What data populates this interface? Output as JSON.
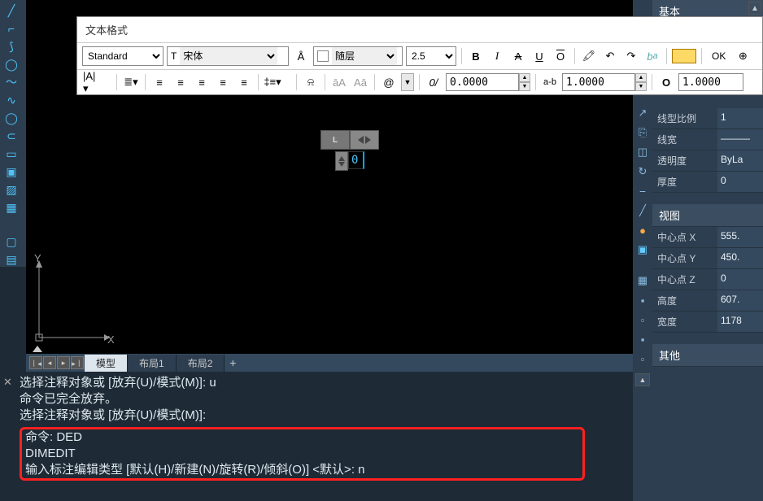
{
  "text_format": {
    "title": "文本格式",
    "style": "Standard",
    "font": "宋体",
    "color": "随层",
    "height": "2.5",
    "bold": "B",
    "italic": "I",
    "strike": "A",
    "underline": "U",
    "overline": "O",
    "ok": "OK",
    "width_factor": "0.0000",
    "tracking": "1.0000",
    "oblique": "1.0000",
    "obl_label": "0/",
    "at_label": "@",
    "ab_label": "a-b",
    "aA": "āA",
    "Aa": "Aā",
    "oval": "O"
  },
  "editor": {
    "text": "0"
  },
  "tabs": {
    "model": "模型",
    "layout1": "布局1",
    "layout2": "布局2"
  },
  "cmd": {
    "l1": "选择注释对象或 [放弃(U)/模式(M)]: u",
    "l2": "命令已完全放弃。",
    "l3": "选择注释对象或 [放弃(U)/模式(M)]:",
    "l4": "命令: DED",
    "l5": "DIMEDIT",
    "l6": "输入标注编辑类型 [默认(H)/新建(N)/旋转(R)/倾斜(O)] <默认>: n"
  },
  "props": {
    "basic_hdr": "基本",
    "ltscale_lbl": "线型比例",
    "ltscale_val": "1",
    "lweight_lbl": "线宽",
    "lweight_val": "———",
    "trans_lbl": "透明度",
    "trans_val": "ByLa",
    "thick_lbl": "厚度",
    "thick_val": "0",
    "view_hdr": "视图",
    "cx_lbl": "中心点 X",
    "cx_val": "555.",
    "cy_lbl": "中心点 Y",
    "cy_val": "450.",
    "cz_lbl": "中心点 Z",
    "cz_val": "0",
    "h_lbl": "高度",
    "h_val": "607.",
    "w_lbl": "宽度",
    "w_val": "1178",
    "other_hdr": "其他"
  },
  "ucs": {
    "x": "X",
    "y": "Y"
  }
}
